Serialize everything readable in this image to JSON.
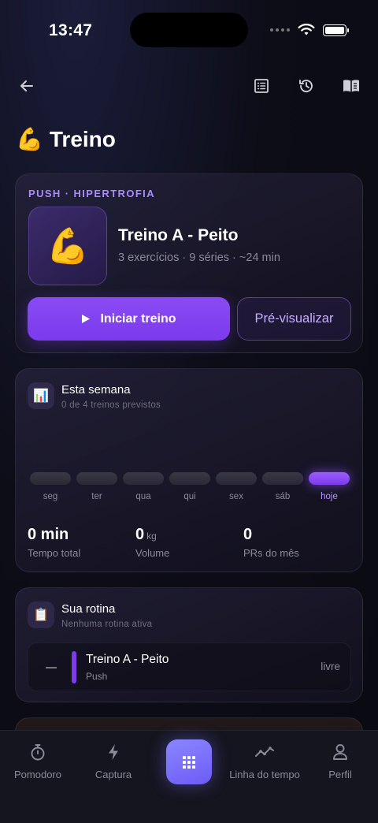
{
  "status_bar": {
    "time": "13:47"
  },
  "top_nav": {
    "back_icon": "arrow-left-icon",
    "actions": [
      "list-icon",
      "history-icon",
      "book-open-icon"
    ]
  },
  "page": {
    "title_emoji": "💪",
    "title": "Treino"
  },
  "workout_card": {
    "tag": "PUSH · HIPERTROFIA",
    "emoji": "💪",
    "name": "Treino A - Peito",
    "meta": "3 exercícios · 9 séries · ~24 min",
    "start_label": "Iniciar treino",
    "preview_label": "Pré-visualizar"
  },
  "week_card": {
    "icon": "📊",
    "title": "Esta semana",
    "subtitle": "0 de 4 treinos previstos",
    "days": [
      {
        "label": "seg",
        "active": false
      },
      {
        "label": "ter",
        "active": false
      },
      {
        "label": "qua",
        "active": false
      },
      {
        "label": "qui",
        "active": false
      },
      {
        "label": "sex",
        "active": false
      },
      {
        "label": "sáb",
        "active": false
      },
      {
        "label": "hoje",
        "active": true
      }
    ],
    "stats": [
      {
        "value": "0 min",
        "unit": "",
        "label": "Tempo total"
      },
      {
        "value": "0",
        "unit": "kg",
        "label": "Volume"
      },
      {
        "value": "0",
        "unit": "",
        "label": "PRs do mês"
      }
    ]
  },
  "routine_card": {
    "icon": "📋",
    "title": "Sua rotina",
    "subtitle": "Nenhuma rotina ativa",
    "item": {
      "dash": "—",
      "name": "Treino A - Peito",
      "type": "Push",
      "status": "livre"
    }
  },
  "tab_bar": {
    "tabs": [
      {
        "label": "Pomodoro",
        "icon": "stopwatch-icon"
      },
      {
        "label": "Captura",
        "icon": "lightning-icon"
      },
      {
        "label": "",
        "icon": "grid-icon"
      },
      {
        "label": "Linha do tempo",
        "icon": "activity-icon"
      },
      {
        "label": "Perfil",
        "icon": "user-icon"
      }
    ]
  },
  "colors": {
    "accent": "#7c3aed",
    "accent_light": "#a68cff",
    "tab_center": "#7b6ff8"
  }
}
